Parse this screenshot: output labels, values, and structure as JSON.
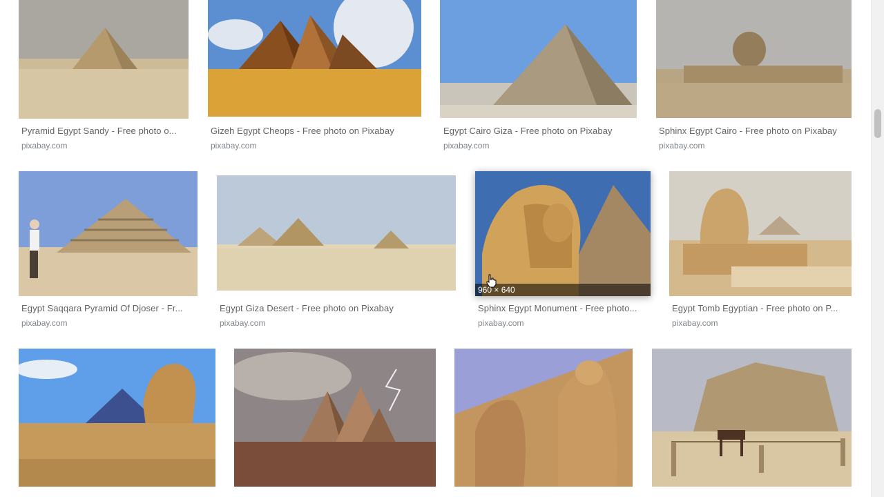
{
  "results": [
    {
      "title": "Pyramid Egypt Sandy - Free photo o...",
      "source": "pixabay.com"
    },
    {
      "title": "Gizeh Egypt Cheops - Free photo on Pixabay",
      "source": "pixabay.com"
    },
    {
      "title": "Egypt Cairo Giza - Free photo on Pixabay",
      "source": "pixabay.com"
    },
    {
      "title": "Sphinx Egypt Cairo - Free photo on Pixabay",
      "source": "pixabay.com"
    },
    {
      "title": "Egypt Saqqara Pyramid Of Djoser - Fr...",
      "source": "pixabay.com"
    },
    {
      "title": "Egypt Giza Desert - Free photo on Pixabay",
      "source": "pixabay.com"
    },
    {
      "title": "Sphinx Egypt Monument - Free photo...",
      "source": "pixabay.com",
      "dimensions": "960 × 640"
    },
    {
      "title": "Egypt Tomb Egyptian - Free photo on P...",
      "source": "pixabay.com"
    }
  ],
  "icons": {
    "cursor": "hand-pointer-icon"
  }
}
